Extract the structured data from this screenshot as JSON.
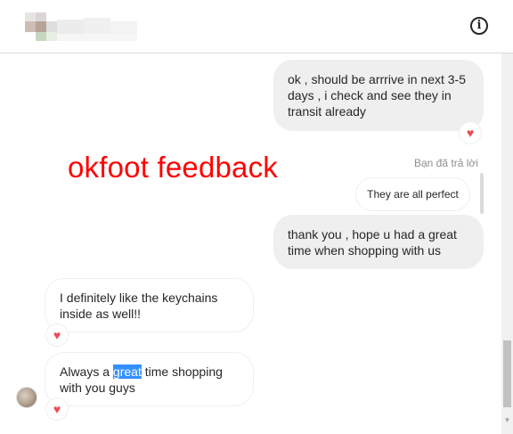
{
  "header": {
    "info_icon_glyph": "i"
  },
  "overlay": {
    "text": "okfoot feedback",
    "color": "#ff0000"
  },
  "messages": [
    {
      "id": "sent-1",
      "direction": "sent",
      "text": "ok , should be arrrive in next 3-5 days , i check and see they in transit already",
      "reaction": "heart"
    },
    {
      "id": "sent-2",
      "direction": "sent",
      "reply_label": "Bạn đã trả lời",
      "reply_quote": "They are all perfect",
      "text": "thank you , hope u had a great time when shopping with us"
    },
    {
      "id": "recv-1",
      "direction": "received",
      "text": "I definitely like the keychains inside as well!!",
      "reaction": "heart"
    },
    {
      "id": "recv-2",
      "direction": "received",
      "text_before": "Always a ",
      "text_highlight": "great",
      "text_after": " time shopping with you guys",
      "reaction": "heart"
    }
  ],
  "colors": {
    "sent_bubble": "#efefef",
    "heart": "#ed4956",
    "selection": "#3390ff"
  },
  "icons": {
    "heart": "♥",
    "scroll_down": "▼"
  }
}
